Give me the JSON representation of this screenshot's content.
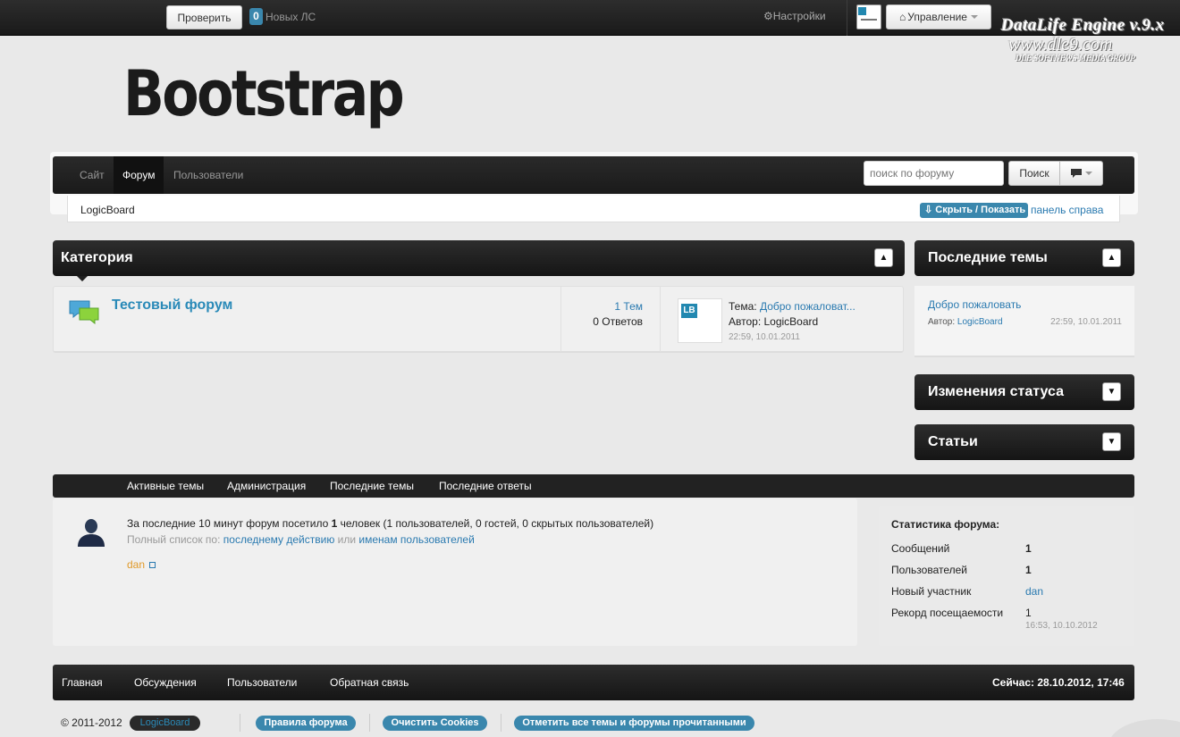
{
  "topbar": {
    "check_label": "Проверить",
    "pm_count": "0",
    "pm_text": "Новых ЛС",
    "settings_label": "Настройки",
    "manage_label": "Управление"
  },
  "dle_logo": {
    "line1": "DataLife Engine v.9.x",
    "line2": "www.dle9.com",
    "line3": "DLE SOFTNEWS MEDIA GROUP"
  },
  "brand": "Bootstrap",
  "nav": {
    "items": [
      "Сайт",
      "Форум",
      "Пользователи"
    ],
    "active": "Форум",
    "search_placeholder": "поиск по форуму",
    "search_button": "Поиск"
  },
  "breadcrumb": {
    "text": "LogicBoard",
    "toggle_label": "Скрыть / Показать",
    "right_link": "панель справа"
  },
  "category": {
    "title": "Категория",
    "forum_name": "Тестовый форум",
    "topics": "1 Тем",
    "replies": "0 Ответов",
    "last_topic_prefix": "Тема:",
    "last_topic_title": "Добро пожаловат...",
    "last_author": "Автор: LogicBoard",
    "last_date": "22:59, 10.01.2011",
    "avatar_text": "LB"
  },
  "sidebar": {
    "latest_title": "Последние темы",
    "latest_item": "Добро пожаловать",
    "latest_author_label": "Автор:",
    "latest_author": "LogicBoard",
    "latest_date": "22:59, 10.01.2011",
    "status_title": "Изменения статуса",
    "articles_title": "Статьи"
  },
  "tabs": [
    "Активные темы",
    "Администрация",
    "Последние темы",
    "Последние ответы"
  ],
  "online": {
    "line1_a": "За последние 10 минут форум посетило ",
    "line1_count": "1",
    "line1_b": " человек (1 пользователей, 0 гостей, 0 скрытых пользователей)",
    "line2_prefix": "Полный список по: ",
    "line2_link1": "последнему действию",
    "line2_mid": " или ",
    "line2_link2": "именам пользователей",
    "user": "dan"
  },
  "stats": {
    "title": "Статистика форума:",
    "rows": [
      {
        "label": "Сообщений",
        "value": "1"
      },
      {
        "label": "Пользователей",
        "value": "1"
      },
      {
        "label": "Новый участник",
        "value": "dan"
      },
      {
        "label": "Рекорд посещаемости",
        "value": "1"
      }
    ],
    "record_date": "16:53, 10.10.2012"
  },
  "footer": {
    "links": [
      "Главная",
      "Обсуждения",
      "Пользователи",
      "Обратная связь"
    ],
    "now": "Сейчас: 28.10.2012, 17:46",
    "copyright": "© 2011-2012",
    "brand_pill": "LogicBoard",
    "rules": "Правила форума",
    "cookies": "Очистить Cookies",
    "mark_read": "Отметить все темы и форумы прочитанными"
  },
  "colors": {
    "accent": "#3a87ad",
    "link": "#2a7ab0",
    "bar": "#1e1e1e"
  }
}
